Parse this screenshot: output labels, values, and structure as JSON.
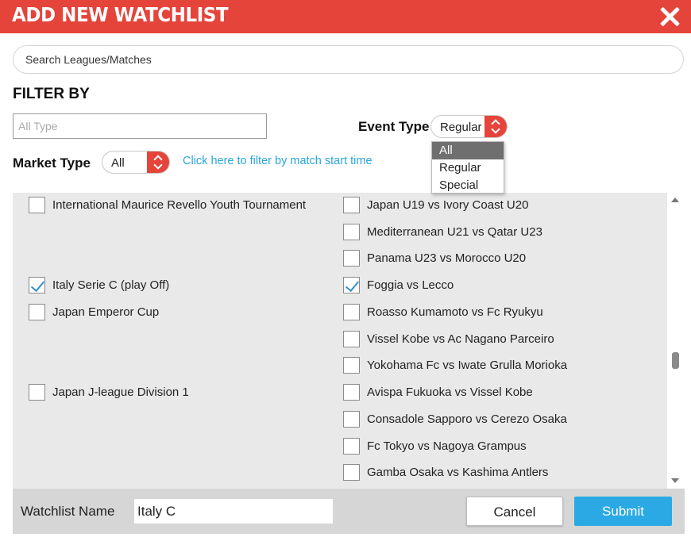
{
  "dialog": {
    "title": "ADD NEW WATCHLIST",
    "close_icon": "close-icon",
    "accent_color": "#e5443b"
  },
  "search": {
    "placeholder": "Search Leagues/Matches",
    "value": ""
  },
  "filter": {
    "heading": "FILTER BY",
    "type_placeholder": "All Type",
    "event_type_label": "Event Type",
    "event_type_value": "Regular",
    "event_type_options": [
      "All",
      "Regular",
      "Special"
    ],
    "event_type_highlighted": "All",
    "market_type_label": "Market Type",
    "market_type_value": "All",
    "time_filter_link": "Click here to filter by match start time"
  },
  "leagues": [
    {
      "name": "International Maurice Revello Youth Tournament",
      "checked": false
    },
    {
      "name": "Italy Serie C (play Off)",
      "checked": true
    },
    {
      "name": "Japan Emperor Cup",
      "checked": false
    },
    {
      "name": "Japan J-league Division 1",
      "checked": false
    }
  ],
  "matches": [
    {
      "name": "Japan U19 vs Ivory Coast U20",
      "checked": false
    },
    {
      "name": "Mediterranean U21 vs Qatar U23",
      "checked": false
    },
    {
      "name": "Panama U23 vs Morocco U20",
      "checked": false
    },
    {
      "name": "Foggia vs Lecco",
      "checked": true
    },
    {
      "name": "Roasso Kumamoto vs Fc Ryukyu",
      "checked": false
    },
    {
      "name": "Vissel Kobe vs Ac Nagano Parceiro",
      "checked": false
    },
    {
      "name": "Yokohama Fc vs Iwate Grulla Morioka",
      "checked": false
    },
    {
      "name": "Avispa Fukuoka vs Vissel Kobe",
      "checked": false
    },
    {
      "name": "Consadole Sapporo vs Cerezo Osaka",
      "checked": false
    },
    {
      "name": "Fc Tokyo vs Nagoya Grampus",
      "checked": false
    },
    {
      "name": "Gamba Osaka vs Kashima Antlers",
      "checked": false
    }
  ],
  "footer": {
    "watchlist_name_label": "Watchlist Name",
    "watchlist_name_value": "Italy C",
    "cancel_label": "Cancel",
    "submit_label": "Submit"
  }
}
